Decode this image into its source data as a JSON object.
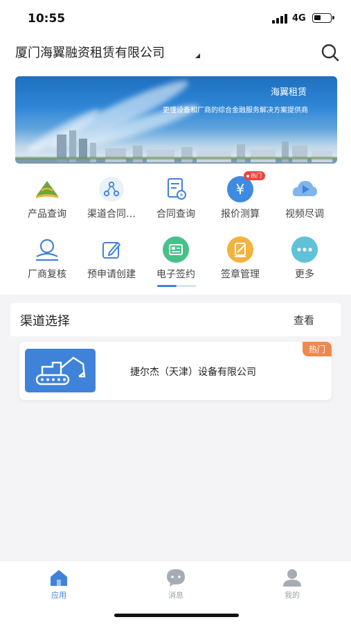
{
  "status_bar": {
    "time": "10:55",
    "network": "4G"
  },
  "header": {
    "company": "厦门海翼融资租赁有限公司"
  },
  "banner": {
    "title": "海翼租赁",
    "subtitle": "更懂设备和厂商的综合金融服务解决方案提供商"
  },
  "grid": {
    "row1": [
      {
        "label": "产品查询",
        "icon": "product-query-icon"
      },
      {
        "label": "渠道合同…",
        "icon": "channel-contract-icon"
      },
      {
        "label": "合同查询",
        "icon": "contract-query-icon"
      },
      {
        "label": "报价测算",
        "icon": "quote-calc-icon",
        "badge": "热门"
      },
      {
        "label": "视频尽调",
        "icon": "video-dd-icon"
      }
    ],
    "row2": [
      {
        "label": "厂商复核",
        "icon": "vendor-review-icon"
      },
      {
        "label": "预申请创建",
        "icon": "pre-apply-icon"
      },
      {
        "label": "电子签约",
        "icon": "e-sign-icon"
      },
      {
        "label": "签章管理",
        "icon": "seal-manage-icon"
      },
      {
        "label": "更多",
        "icon": "more-icon"
      }
    ]
  },
  "channel": {
    "title": "渠道选择",
    "view_label": "查看",
    "vendor": {
      "name": "捷尔杰（天津）设备有限公司",
      "badge": "热门"
    }
  },
  "tabbar": [
    {
      "label": "应用",
      "active": true
    },
    {
      "label": "消息",
      "active": false
    },
    {
      "label": "我的",
      "active": false
    }
  ],
  "colors": {
    "accent": "#3f82d9",
    "hot": "#e8453c",
    "hot_tag": "#f0884e",
    "tab_inactive": "#9aa0a8"
  }
}
